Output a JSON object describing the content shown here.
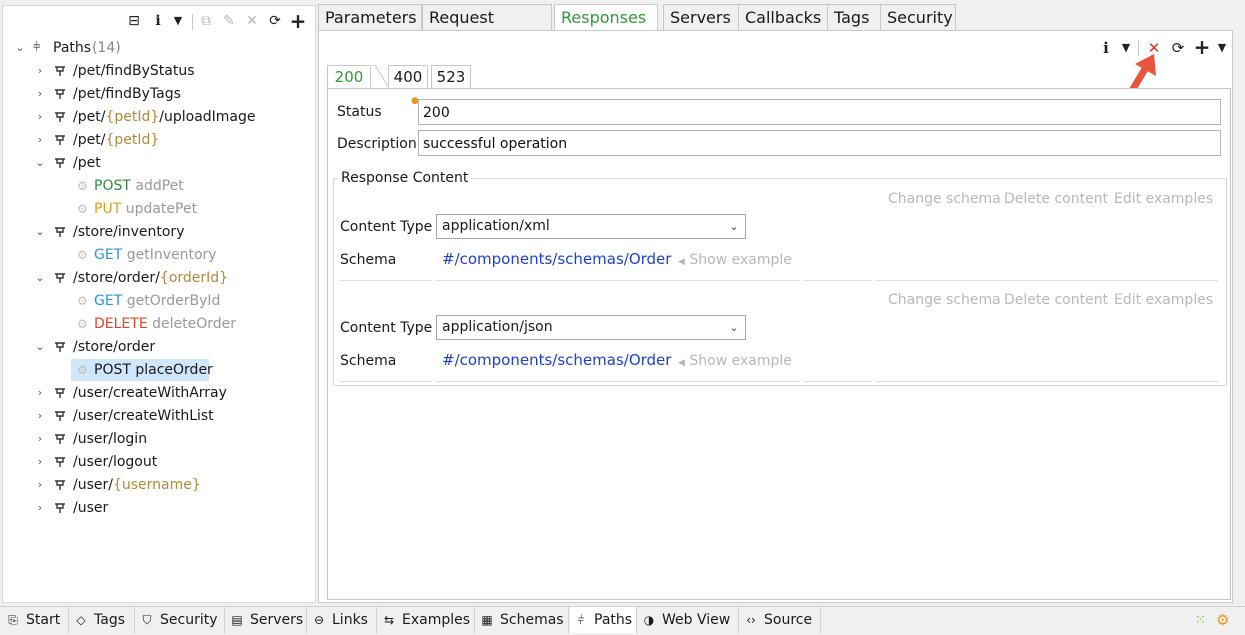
{
  "left_toolbar": {
    "collapse_icon": "collapse-all-icon",
    "info_icon": "info-icon",
    "dropdown_icon": "chevron-down-icon",
    "copy_icon": "copy-icon",
    "edit_icon": "edit-icon",
    "delete_icon": "delete-icon",
    "refresh_icon": "refresh-icon",
    "add_icon": "add-icon"
  },
  "tree": {
    "root_label": "Paths",
    "root_count": "(14)",
    "paths": [
      {
        "prefix": "/pet/findByStatus",
        "param": "",
        "suffix": ""
      },
      {
        "prefix": "/pet/findByTags",
        "param": "",
        "suffix": ""
      },
      {
        "prefix": "/pet/",
        "param": "{petId}",
        "suffix": "/uploadImage"
      },
      {
        "prefix": "/pet/",
        "param": "{petId}",
        "suffix": ""
      },
      {
        "prefix": "/pet",
        "param": "",
        "suffix": ""
      },
      {
        "prefix": "/store/inventory",
        "param": "",
        "suffix": ""
      },
      {
        "prefix": "/store/order/",
        "param": "{orderId}",
        "suffix": ""
      },
      {
        "prefix": "/store/order",
        "param": "",
        "suffix": ""
      },
      {
        "prefix": "/user/createWithArray",
        "param": "",
        "suffix": ""
      },
      {
        "prefix": "/user/createWithList",
        "param": "",
        "suffix": ""
      },
      {
        "prefix": "/user/login",
        "param": "",
        "suffix": ""
      },
      {
        "prefix": "/user/logout",
        "param": "",
        "suffix": ""
      },
      {
        "prefix": "/user/",
        "param": "{username}",
        "suffix": ""
      },
      {
        "prefix": "/user",
        "param": "",
        "suffix": ""
      }
    ],
    "ops": [
      {
        "method": "POST",
        "name": "addPet"
      },
      {
        "method": "PUT",
        "name": "updatePet"
      },
      {
        "method": "GET",
        "name": "getInventory"
      },
      {
        "method": "GET",
        "name": "getOrderById"
      },
      {
        "method": "DELETE",
        "name": "deleteOrder"
      },
      {
        "method": "POST",
        "name": "placeOrder"
      }
    ]
  },
  "top_tabs": [
    "Parameters",
    "Request Bodies",
    "Responses",
    "Servers",
    "Callbacks",
    "Tags",
    "Security"
  ],
  "response_tabs": [
    "200",
    "400",
    "523"
  ],
  "form": {
    "status_label": "Status",
    "status_value": "200",
    "description_label": "Description",
    "description_value": "successful operation",
    "response_content_label": "Response Content",
    "content_type_label": "Content Type",
    "schema_label": "Schema",
    "change_schema": "Change schema",
    "delete_content": "Delete content",
    "edit_examples": "Edit examples",
    "show_example": "Show example",
    "contents": [
      {
        "content_type": "application/xml",
        "schema": "#/components/schemas/Order"
      },
      {
        "content_type": "application/json",
        "schema": "#/components/schemas/Order"
      }
    ]
  },
  "bottom_tabs": [
    "Start",
    "Tags",
    "Security",
    "Servers",
    "Links",
    "Examples",
    "Schemas",
    "Paths",
    "Web View",
    "Source"
  ],
  "colors": {
    "accent_green": "#2e9a3a",
    "link_blue": "#1f3fd0",
    "param_brown": "#b08a3a",
    "annotation_red": "#e8553f"
  }
}
